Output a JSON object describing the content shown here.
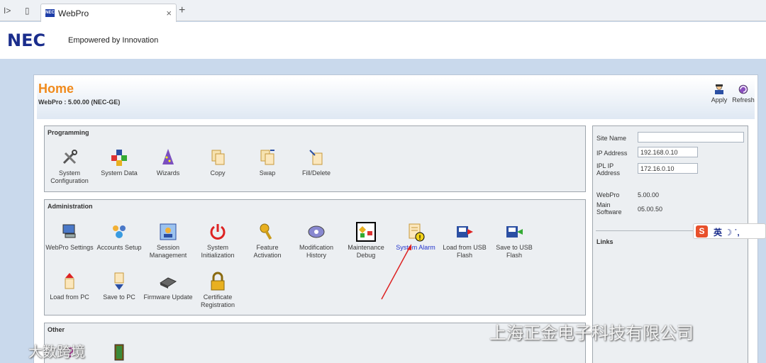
{
  "browser": {
    "tab_title": "WebPro",
    "favicon_text": "NEC",
    "close_glyph": "×",
    "new_tab_glyph": "+",
    "toolbar_glyphs": [
      "I>",
      "▯"
    ]
  },
  "brand": {
    "logo": "NEC",
    "tagline": "Empowered by Innovation",
    "accent_color": "#f08a1c",
    "logo_color": "#1a2d8c"
  },
  "page": {
    "title": "Home",
    "version": "WebPro : 5.00.00 (NEC-GE)",
    "apply_label": "Apply",
    "refresh_label": "Refresh"
  },
  "programming": {
    "title": "Programming",
    "items": [
      {
        "label": "System Configuration",
        "icon": "tools-icon"
      },
      {
        "label": "System Data",
        "icon": "cubes-icon"
      },
      {
        "label": "Wizards",
        "icon": "wizard-icon"
      },
      {
        "label": "Copy",
        "icon": "copy-icon"
      },
      {
        "label": "Swap",
        "icon": "swap-icon"
      },
      {
        "label": "Fill/Delete",
        "icon": "fill-delete-icon"
      }
    ]
  },
  "administration": {
    "title": "Administration",
    "items": [
      {
        "label": "WebPro Settings",
        "icon": "computer-icon"
      },
      {
        "label": "Accounts Setup",
        "icon": "users-icon"
      },
      {
        "label": "Session Management",
        "icon": "session-icon"
      },
      {
        "label": "System Initialization",
        "icon": "power-icon"
      },
      {
        "label": "Feature Activation",
        "icon": "key-icon"
      },
      {
        "label": "Modification History",
        "icon": "history-icon"
      },
      {
        "label": "Maintenance Debug",
        "icon": "debug-icon"
      },
      {
        "label": "System Alarm",
        "icon": "alarm-icon"
      },
      {
        "label": "Load from USB Flash",
        "icon": "usb-load-icon"
      },
      {
        "label": "Save to USB Flash",
        "icon": "usb-save-icon"
      },
      {
        "label": "Load from PC",
        "icon": "pc-load-icon"
      },
      {
        "label": "Save to PC",
        "icon": "pc-save-icon"
      },
      {
        "label": "Firmware Update",
        "icon": "firmware-icon"
      },
      {
        "label": "Certificate Registration",
        "icon": "lock-icon"
      }
    ]
  },
  "other": {
    "title": "Other",
    "items": [
      {
        "label": "",
        "icon": "help-icon"
      },
      {
        "label": "",
        "icon": "exit-door-icon"
      }
    ]
  },
  "site_info": {
    "site_name_label": "Site Name",
    "site_name_value": "",
    "ip_label": "IP Address",
    "ip_value": "192.168.0.10",
    "ipl_label": "IPL IP Address",
    "ipl_value": "172.16.0.10",
    "webpro_label": "WebPro",
    "webpro_value": "5.00.00",
    "main_sw_label": "Main Software",
    "main_sw_value": "05.00.50",
    "links_label": "Links"
  },
  "overlays": {
    "ime_s": "S",
    "ime_text": "英 ☽ ˙,",
    "watermark_main": "上海正金电子科技有限公司",
    "watermark_small": "大数跨境"
  }
}
